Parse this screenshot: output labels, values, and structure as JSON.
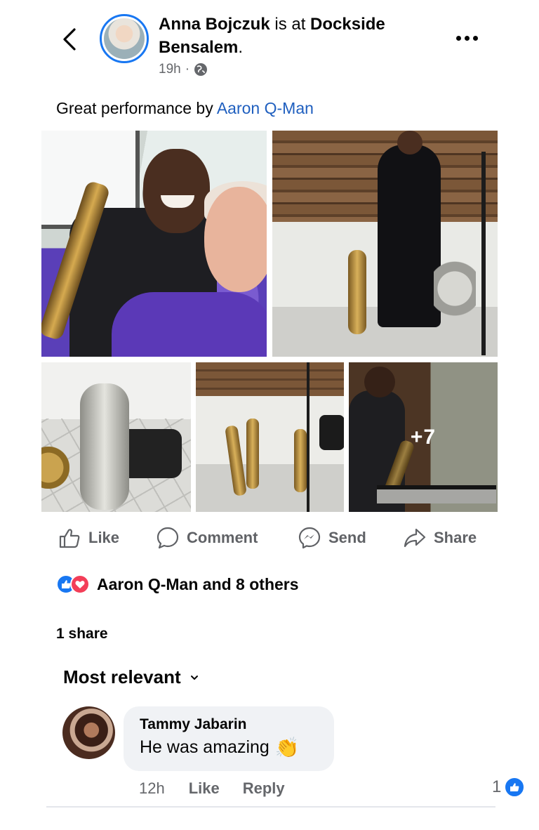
{
  "header": {
    "author": "Anna Bojczuk",
    "connector": " is at ",
    "place": "Dockside Bensalem",
    "place_suffix": ".",
    "time": "19h",
    "dot": "·",
    "audience_icon": "globe-icon"
  },
  "post": {
    "caption_prefix": "Great performance by ",
    "caption_mention": "Aaron Q-Man",
    "more_photos": "+7"
  },
  "actions": {
    "like": "Like",
    "comment": "Comment",
    "send": "Send",
    "share": "Share"
  },
  "reactions": {
    "summary": "Aaron Q-Man and 8 others",
    "icons": [
      "like-reaction-icon",
      "love-reaction-icon"
    ]
  },
  "shares": "1 share",
  "comments_sort": "Most relevant",
  "comments": [
    {
      "author": "Tammy Jabarin",
      "text": "He was amazing",
      "emoji": "👏",
      "time": "12h",
      "like_label": "Like",
      "reply_label": "Reply",
      "like_count": "1"
    }
  ],
  "colors": {
    "accent": "#1877f2",
    "mention": "#1f5fbf",
    "secondary_text": "#65676b",
    "bubble": "#f0f2f5",
    "love": "#f33e58"
  }
}
